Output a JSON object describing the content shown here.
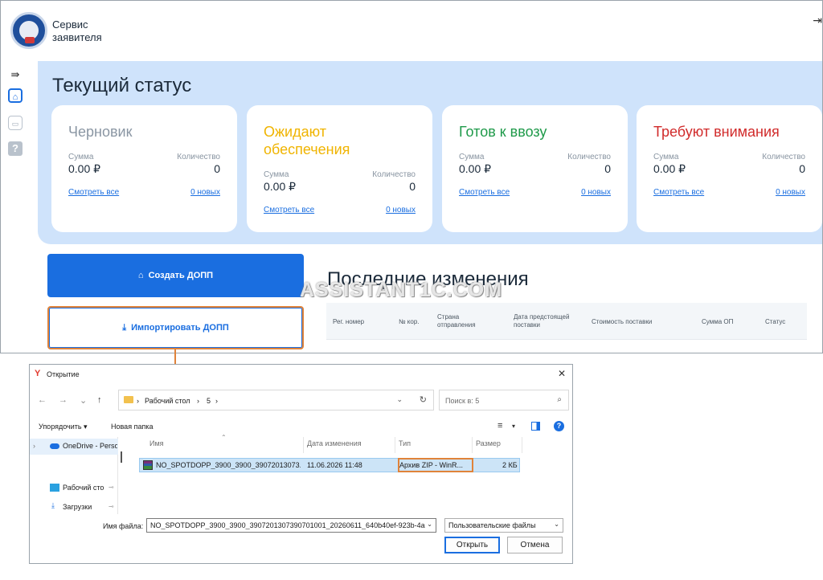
{
  "app": {
    "service_title": "Сервис заявителя",
    "section_title": "Текущий статус",
    "cards": [
      {
        "title": "Черновик",
        "color": "#8a96a3",
        "sum_label": "Сумма",
        "sum": "0.00 ₽",
        "count_label": "Количество",
        "count": "0",
        "see_all": "Смотреть все",
        "new": "0 новых"
      },
      {
        "title": "Ожидают обеспечения",
        "color": "#f0b400",
        "sum_label": "Сумма",
        "sum": "0.00 ₽",
        "count_label": "Количество",
        "count": "0",
        "see_all": "Смотреть все",
        "new": "0 новых"
      },
      {
        "title": "Готов к ввозу",
        "color": "#1f9a4a",
        "sum_label": "Сумма",
        "sum": "0.00 ₽",
        "count_label": "Количество",
        "count": "0",
        "see_all": "Смотреть все",
        "new": "0 новых"
      },
      {
        "title": "Требуют внимания",
        "color": "#d12b2b",
        "sum_label": "Сумма",
        "sum": "0.00 ₽",
        "count_label": "Количество",
        "count": "0",
        "see_all": "Смотреть все",
        "new": "0 новых"
      }
    ],
    "create_button": "Создать ДОПП",
    "import_button": "Импортировать ДОПП",
    "recent_title": "Последние изменения",
    "recent_columns": [
      "Рег. номер",
      "№ кор.",
      "Страна отправления",
      "Дата предстоящей поставки",
      "Стоимость поставки",
      "Сумма ОП",
      "Статус"
    ],
    "watermark": "ASSISTANT1C.COM"
  },
  "dialog": {
    "title": "Открытие",
    "breadcrumb": [
      "Рабочий стол",
      "5"
    ],
    "search_placeholder": "Поиск в: 5",
    "organize": "Упорядочить ▾",
    "new_folder": "Новая папка",
    "nav_items": [
      "OneDrive - Perso",
      "Рабочий сто",
      "Загрузки"
    ],
    "columns": [
      "Имя",
      "Дата изменения",
      "Тип",
      "Размер"
    ],
    "file": {
      "name": "NO_SPOTDOPP_3900_3900_39072013073...",
      "date": "11.06.2026 11:48",
      "type": "Архив ZIP - WinR...",
      "size": "2 КБ"
    },
    "filename_label": "Имя файла:",
    "filename_value": "NO_SPOTDOPP_3900_3900_3907201307390701001_20260611_640b40ef-923b-4a7",
    "filetype_value": "Пользовательские файлы",
    "open_button": "Открыть",
    "cancel_button": "Отмена"
  }
}
